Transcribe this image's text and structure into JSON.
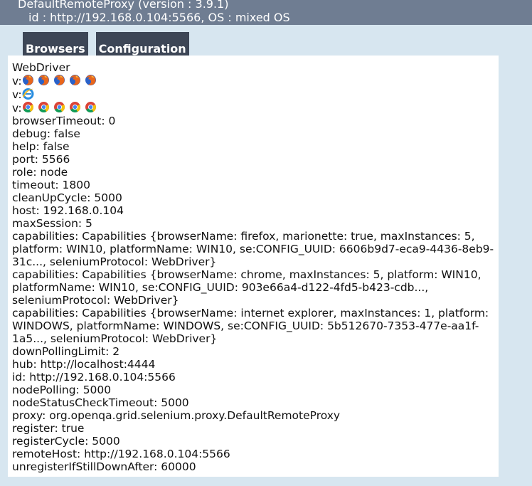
{
  "header": {
    "title": "DefaultRemoteProxy (version : 3.9.1)",
    "subtitle": "id : http://192.168.0.104:5566, OS : mixed OS"
  },
  "tabs": [
    {
      "label": "Browsers"
    },
    {
      "label": "Configuration"
    }
  ],
  "content": {
    "heading": "WebDriver",
    "browser_rows": [
      {
        "prefix": "v:",
        "icon": "firefox-icon",
        "count": 5
      },
      {
        "prefix": "v:",
        "icon": "internet-explorer-icon",
        "count": 1
      },
      {
        "prefix": "v:",
        "icon": "chrome-icon",
        "count": 5
      }
    ],
    "config": [
      "browserTimeout: 0",
      "debug: false",
      "help: false",
      "port: 5566",
      "role: node",
      "timeout: 1800",
      "cleanUpCycle: 5000",
      "host: 192.168.0.104",
      "maxSession: 5",
      "capabilities: Capabilities {browserName: firefox, marionette: true, maxInstances: 5, platform: WIN10, platformName: WIN10, se:CONFIG_UUID: 6606b9d7-eca9-4436-8eb9-31c..., seleniumProtocol: WebDriver}",
      "capabilities: Capabilities {browserName: chrome, maxInstances: 5, platform: WIN10, platformName: WIN10, se:CONFIG_UUID: 903e66a4-d122-4fd5-b423-cdb..., seleniumProtocol: WebDriver}",
      "capabilities: Capabilities {browserName: internet explorer, maxInstances: 1, platform: WINDOWS, platformName: WINDOWS, se:CONFIG_UUID: 5b512670-7353-477e-aa1f-1a5..., seleniumProtocol: WebDriver}",
      "downPollingLimit: 2",
      "hub: http://localhost:4444",
      "id: http://192.168.0.104:5566",
      "nodePolling: 5000",
      "nodeStatusCheckTimeout: 5000",
      "proxy: org.openqa.grid.selenium.proxy.DefaultRemoteProxy",
      "register: true",
      "registerCycle: 5000",
      "remoteHost: http://192.168.0.104:5566",
      "unregisterIfStillDownAfter: 60000"
    ]
  }
}
